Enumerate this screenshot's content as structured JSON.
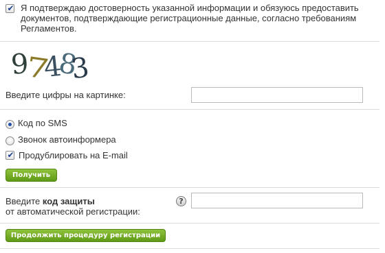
{
  "agreement": {
    "checked": true,
    "lines": [
      "Я подтверждаю достоверность указанной информации и обязуюсь предоставить",
      "документов, подтверждающие регистрационные данные, согласно требованиям",
      "Регламентов."
    ]
  },
  "captcha": {
    "digits": [
      "9",
      "7",
      "4",
      "8",
      "3"
    ],
    "colors": [
      "#2f3f3a",
      "#8a7a2a",
      "#3a4f5f",
      "#4a6a7a",
      "#2a3a4a"
    ],
    "label": "Введите цифры на картинке:",
    "input_value": "",
    "input_placeholder": ""
  },
  "delivery": {
    "options": [
      {
        "label": "Код по SMS",
        "selected": true
      },
      {
        "label": "Звонок автоинформера",
        "selected": false
      }
    ],
    "duplicate_email": {
      "label": "Продублировать на E-mail",
      "checked": true
    },
    "get_button": "Получить"
  },
  "protection": {
    "label_prefix": "Введите ",
    "label_bold": "код защиты",
    "label_line2": "от автоматической регистрации:",
    "help_icon": "?",
    "input_value": "",
    "input_placeholder": ""
  },
  "continue_button": "Продолжить процедуру регистрации",
  "colors": {
    "button_green": "#6aa61e",
    "radio_blue": "#1f4fa8",
    "separator": "#dcdcdc"
  }
}
